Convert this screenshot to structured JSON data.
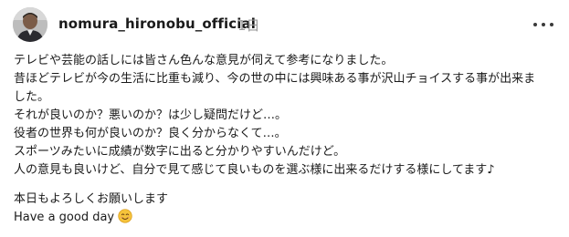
{
  "post": {
    "username": "nomura_hironobu_official",
    "timestamp": "1日",
    "more_icon": "more-horizontal-icon",
    "body_lines": [
      "テレビや芸能の話しには皆さん色んな意見が伺えて参考になりました。",
      "昔ほどテレビが今の生活に比重も減り、今の世の中には興味ある事が沢山チョイスする事が出来ま",
      "した。",
      "それが良いのか？悪いのか？は少し疑問だけど…。",
      "役者の世界も何が良いのか？良く分からなくて…。",
      "スポーツみたいに成績が数字に出ると分かりやすいんだけど。",
      "人の意見も良いけど、自分で見て感じて良いものを選ぶ様に出来るだけする様にしてます♪"
    ],
    "closing_lines": [
      "本日もよろしくお願いします",
      "Have a good day"
    ],
    "closing_emoji": "smiling-face-emoji-icon",
    "colors": {
      "text": "#1a1a1a",
      "muted": "#9a9a9a",
      "emoji": "#f5c33b"
    }
  }
}
